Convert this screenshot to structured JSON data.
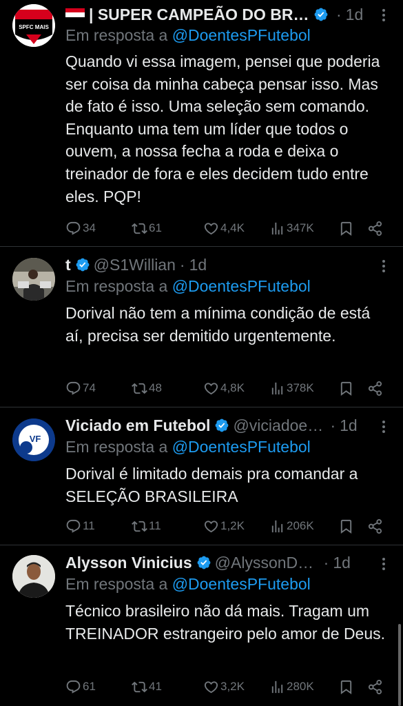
{
  "theme": {
    "background": "#000000",
    "text": "#e7e9ea",
    "muted": "#71767b",
    "accent": "#1d9bf0",
    "divider": "#2f3336"
  },
  "tweets": [
    {
      "name": "| SUPER CAMPEÃO DO BRASIL",
      "handle": "",
      "time": "1d",
      "verified": true,
      "reply_prefix": "Em resposta a ",
      "reply_to": "@DoentesPFutebol",
      "text": "Quando vi essa imagem, pensei que poderia ser coisa da minha cabeça pensar isso. Mas de fato é isso. Uma seleção sem comando. Enquanto uma tem um líder que todos o ouvem, a nossa fecha a roda e deixa o treinador de fora e eles decidem tudo entre eles. PQP!",
      "replies": "34",
      "reposts": "61",
      "likes": "4,4K",
      "views": "347K",
      "avatar_text": "SPFC MAIS"
    },
    {
      "name": "t",
      "handle": "@S1Willian",
      "time": "1d",
      "verified": true,
      "reply_prefix": "Em resposta a ",
      "reply_to": "@DoentesPFutebol",
      "text": "Dorival não tem a mínima condição de está aí, precisa ser demitido urgentemente.",
      "replies": "74",
      "reposts": "48",
      "likes": "4,8K",
      "views": "378K"
    },
    {
      "name": "Viciado em Futebol",
      "handle": "@viciadoemfutebol",
      "time": "1d",
      "verified": true,
      "reply_prefix": "Em resposta a ",
      "reply_to": "@DoentesPFutebol",
      "text": "Dorival é limitado demais pra comandar a SELEÇÃO BRASILEIRA",
      "replies": "11",
      "reposts": "11",
      "likes": "1,2K",
      "views": "206K",
      "avatar_text": "VF"
    },
    {
      "name": "Alysson Vinicius",
      "handle": "@AlyssonDutra",
      "time": "1d",
      "verified": true,
      "reply_prefix": "Em resposta a ",
      "reply_to": "@DoentesPFutebol",
      "text": "Técnico brasileiro não dá mais. Tragam um TREINADOR estrangeiro pelo amor de Deus.",
      "replies": "61",
      "reposts": "41",
      "likes": "3,2K",
      "views": "280K"
    }
  ]
}
